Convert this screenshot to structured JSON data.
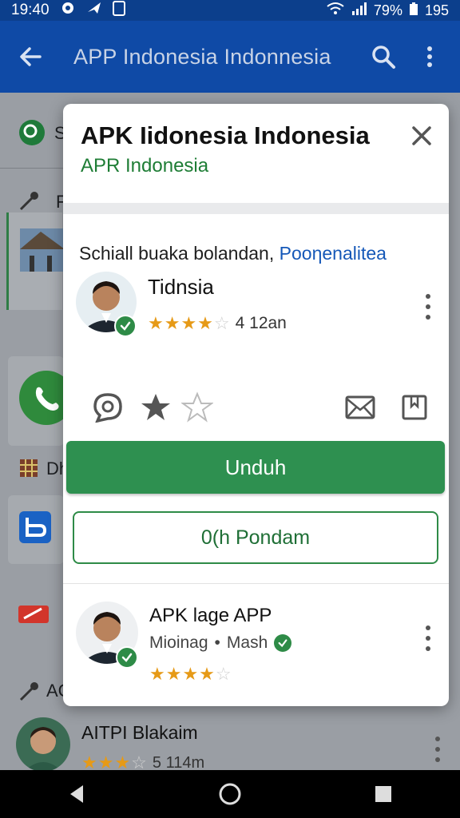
{
  "status_bar": {
    "time": "19:40",
    "battery": "79%",
    "extra": "195"
  },
  "app_bar": {
    "title": "APP Indonesia  Indonnesia"
  },
  "background": {
    "items": [
      {
        "label": "S"
      },
      {
        "label": "F"
      },
      {
        "label": "Dh"
      },
      {
        "label": "AC"
      }
    ],
    "bottom_item": {
      "name": "AITPI Blakaim",
      "meta": "5 114m"
    }
  },
  "modal": {
    "title": "APK Iidonesia Indonesia",
    "subtitle": "APR Indonesia",
    "lead_text": "Schiall buaka bolandan,",
    "lead_link": "Pooηenalitea",
    "app": {
      "name": "Tidnsia",
      "rating_value": 4,
      "rating_text": "4 12an"
    },
    "primary_button": "Unduh",
    "secondary_button": "0(h Pondam",
    "second_app": {
      "name": "APK lage APP",
      "developer": "Mioinag",
      "separator": "•",
      "tag": "Mash",
      "rating_value": 4
    }
  },
  "colors": {
    "accent": "#2e9050",
    "app_bar": "#0f4aa6",
    "star": "#e69a17",
    "link": "#1558b8"
  }
}
